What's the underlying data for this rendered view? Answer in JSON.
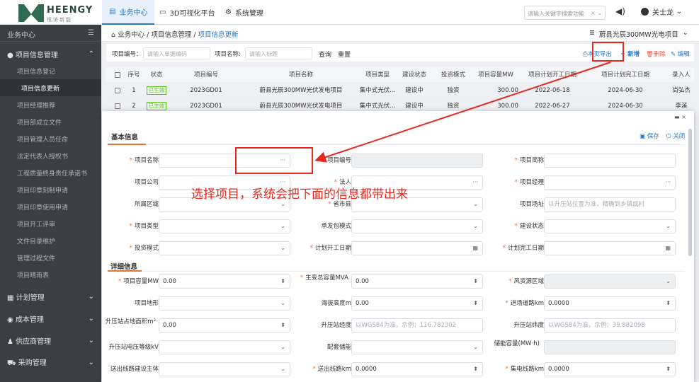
{
  "header": {
    "logo_name": "HEENGY",
    "logo_sub": "恒济新能",
    "nav": [
      {
        "label": "业务中心",
        "icon": "monitor-icon"
      },
      {
        "label": "3D可视化平台",
        "icon": "screen-icon"
      },
      {
        "label": "系统管理",
        "icon": "gear-icon"
      }
    ],
    "search_placeholder": "请输入关键字搜索功能",
    "search_clear": "×",
    "search_caret": "⌄",
    "user_name": "关士龙"
  },
  "sidebar": {
    "title": "业务中心",
    "groups": [
      {
        "label": "项目信息管理",
        "expanded": true,
        "items": [
          "项目信息登记",
          "项目信息更新",
          "项目经理推荐",
          "项目部成立文件",
          "项目管理人员任命",
          "法定代表人授权书",
          "工程质量终身责任承诺书",
          "项目印章刻制申请",
          "项目印章使用申请",
          "项目开工评审",
          "文件目录维护",
          "管理过程文件",
          "项目晴雨表"
        ]
      },
      {
        "label": "计划管理"
      },
      {
        "label": "成本管理"
      },
      {
        "label": "供应商管理"
      },
      {
        "label": "采购管理"
      }
    ],
    "active_item": "项目信息更新"
  },
  "breadcrumb": {
    "home": "业务中心",
    "level1": "项目信息管理",
    "sep": "/",
    "current": "项目信息更新"
  },
  "project_selector": "蔚县光辰300MW光电项目",
  "filter": {
    "code_label": "项目编号：",
    "code_placeholder": "请输入单据编码",
    "name_label": "项目名称:",
    "name_placeholder": "请输入标题",
    "query": "查询",
    "reset": "重置",
    "export": "本页导出",
    "add": "+ 新增",
    "delete": "删除",
    "edit": "编辑"
  },
  "table": {
    "headers": [
      "序号",
      "状态",
      "项目编号",
      "项目名称",
      "项目类型",
      "建设状态",
      "投资模式",
      "项目容量MW",
      "项目计划开工日期",
      "项目计划完工日期",
      "录入人"
    ],
    "rows": [
      [
        "1",
        "已生效",
        "2023GD01",
        "蔚县光辰300MW光伏发电项目",
        "集中式光伏...",
        "建设中",
        "独资",
        "300.00",
        "2022-06-18",
        "2024-06-30",
        "尚弘杰"
      ],
      [
        "2",
        "已生效",
        "2023GD01",
        "蔚县光辰300MW光伏发电项目",
        "集中式光伏...",
        "建设中",
        "独资",
        "300.00",
        "2022-06-27",
        "2024-06-30",
        "李溪"
      ]
    ]
  },
  "modal": {
    "title": "基本信息",
    "save": "保存",
    "close": "关闭",
    "section2": "详细信息",
    "fields": {
      "project_name": "项目名称",
      "project_code": "项目编号",
      "project_short": "项目简称",
      "project_company": "项目公司",
      "legal_person": "法人",
      "project_manager": "项目经理",
      "region": "所属区域",
      "province": "省市县",
      "site": "项目场址",
      "site_placeholder": "以升压站位置为准，精确到乡镇或村",
      "project_type": "项目类型",
      "contract_mode": "承发包模式",
      "build_status": "建设状态",
      "invest_mode": "投资模式",
      "plan_start": "计划开工日期",
      "plan_end": "计划完工日期",
      "capacity": "项目容量MW",
      "capacity_val": "0.00",
      "transformer": "主变总容量MVA",
      "transformer_val": "0.00",
      "wind_zone": "风资源区域",
      "terrain": "项目地形",
      "altitude": "海拔高度m",
      "altitude_val": "0.00",
      "road": "进场道路km",
      "road_val": "0.0000",
      "station_area": "升压站占地面积m²",
      "station_area_val": "0.00",
      "lng": "升压站经度",
      "lng_placeholder": "以WGS84为准，示例：116.782302",
      "lat": "升压站纬度",
      "lat_placeholder": "以WGS84为准，示例：39.882098",
      "voltage": "升压站电压等级kV",
      "storage": "配套储能",
      "storage_cap": "储能容量(MW·h)",
      "line_owner": "送出线路建设主体",
      "out_line": "送出线路km",
      "out_line_val": "0.0000",
      "collect_line": "集电线路km",
      "collect_line_val": "0.0000",
      "ellipsis": "···"
    }
  },
  "annotation": "选择项目，系统会把下面的信息都带出来",
  "colors": {
    "accent": "#2b79c2",
    "required": "#e7733a",
    "annotation": "#e8281c",
    "sidebar": "#3b3f45",
    "success": "#52c41a"
  }
}
